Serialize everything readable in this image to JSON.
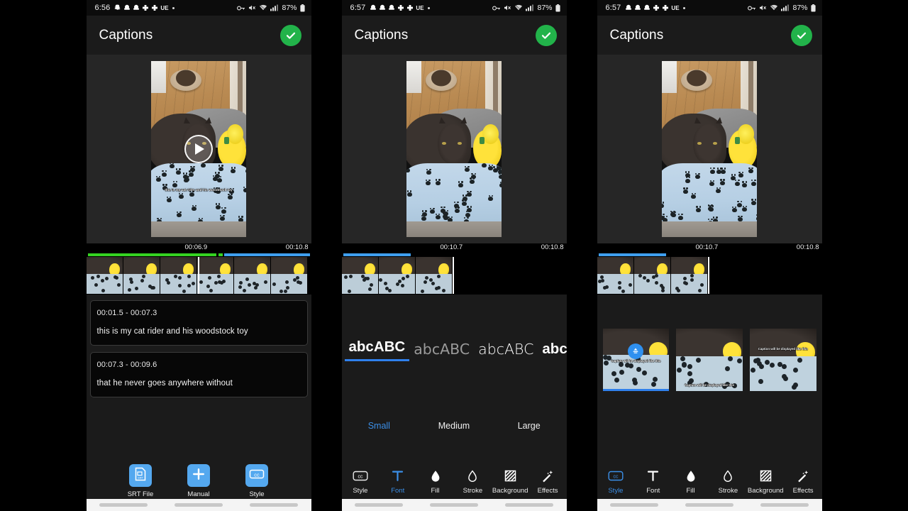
{
  "app": {
    "title": "Captions",
    "done_icon": "check-icon",
    "accent_blue": "#3b8fe8",
    "accent_green": "#22b34a",
    "background": "#1b1b1b"
  },
  "phones": [
    {
      "id": "captions-list",
      "status_bar": {
        "time": "6:56",
        "left_icons": [
          "snapchat-icon",
          "snapchat-icon",
          "snapchat-icon",
          "app-icon",
          "app-icon"
        ],
        "carrier_label": "UE",
        "dot": "•",
        "right_icons": [
          "vpn-key-icon",
          "mute-icon",
          "wifi-icon",
          "signal-icon"
        ],
        "battery": "87%"
      },
      "preview": {
        "play_button": "play-icon",
        "caption_overlay": "this is my cat rider and his woodstock toy"
      },
      "timeline": {
        "playhead_label": "00:06.9",
        "duration_label": "00:10.8",
        "segments": [
          {
            "color": "#35d321",
            "label": "caption-1-range"
          },
          {
            "color": "#3f9fef",
            "label": "caption-2-range"
          }
        ]
      },
      "captions": [
        {
          "range": "00:01.5 - 00:07.3",
          "text": "this is my cat rider and his woodstock toy"
        },
        {
          "range": "00:07.3 - 00:09.6",
          "text": "that he never goes anywhere without"
        }
      ],
      "actions": [
        {
          "icon": "srt-file-icon",
          "label": "SRT File"
        },
        {
          "icon": "plus-icon",
          "label": "Manual"
        },
        {
          "icon": "cc-icon",
          "label": "Style"
        }
      ]
    },
    {
      "id": "font-picker",
      "status_bar": {
        "time": "6:57",
        "left_icons": [
          "snapchat-icon",
          "snapchat-icon",
          "snapchat-icon",
          "app-icon",
          "app-icon"
        ],
        "carrier_label": "UE",
        "dot": "•",
        "right_icons": [
          "vpn-key-icon",
          "mute-icon",
          "wifi-icon",
          "signal-icon"
        ],
        "battery": "87%"
      },
      "timeline": {
        "playhead_label": "00:10.7",
        "duration_label": "00:10.8",
        "segments": [
          {
            "color": "#3f9fef",
            "label": "full-range"
          }
        ]
      },
      "fonts": [
        {
          "sample": "abcABC",
          "selected": true
        },
        {
          "sample": "abcABC",
          "selected": false
        },
        {
          "sample": "abcABC",
          "selected": false
        },
        {
          "sample": "abcA",
          "selected": false
        }
      ],
      "sizes": [
        {
          "label": "Small",
          "selected": true
        },
        {
          "label": "Medium",
          "selected": false
        },
        {
          "label": "Large",
          "selected": false
        }
      ],
      "toolbar": [
        {
          "icon": "cc-icon",
          "label": "Style",
          "active": false
        },
        {
          "icon": "text-t-icon",
          "label": "Font",
          "active": true
        },
        {
          "icon": "fill-droplet-icon",
          "label": "Fill",
          "active": false
        },
        {
          "icon": "stroke-droplet-icon",
          "label": "Stroke",
          "active": false
        },
        {
          "icon": "hatched-square-icon",
          "label": "Background",
          "active": false
        },
        {
          "icon": "magic-wand-icon",
          "label": "Effects",
          "active": false
        }
      ]
    },
    {
      "id": "style-picker",
      "status_bar": {
        "time": "6:57",
        "left_icons": [
          "snapchat-icon",
          "snapchat-icon",
          "snapchat-icon",
          "app-icon",
          "app-icon"
        ],
        "carrier_label": "UE",
        "dot": "•",
        "right_icons": [
          "vpn-key-icon",
          "mute-icon",
          "wifi-icon",
          "signal-icon"
        ],
        "battery": "87%"
      },
      "timeline": {
        "playhead_label": "00:10.7",
        "duration_label": "00:10.8",
        "segments": [
          {
            "color": "#3f9fef",
            "label": "full-range"
          }
        ]
      },
      "presets": [
        {
          "caption": "Caption will be displayed like this",
          "position": "mid",
          "selected": true,
          "badge": "selected-badge-icon"
        },
        {
          "caption": "Caption will be displayed like this",
          "position": "low",
          "selected": false,
          "badge": null
        },
        {
          "caption": "Caption will be displayed like this",
          "position": "high",
          "selected": false,
          "badge": null
        }
      ],
      "toolbar": [
        {
          "icon": "cc-icon",
          "label": "Style",
          "active": true
        },
        {
          "icon": "text-t-icon",
          "label": "Font",
          "active": false
        },
        {
          "icon": "fill-droplet-icon",
          "label": "Fill",
          "active": false
        },
        {
          "icon": "stroke-droplet-icon",
          "label": "Stroke",
          "active": false
        },
        {
          "icon": "hatched-square-icon",
          "label": "Background",
          "active": false
        },
        {
          "icon": "magic-wand-icon",
          "label": "Effects",
          "active": false
        }
      ]
    }
  ],
  "nav_bar": {
    "pills": [
      "recents-pill",
      "home-pill",
      "back-pill"
    ]
  }
}
